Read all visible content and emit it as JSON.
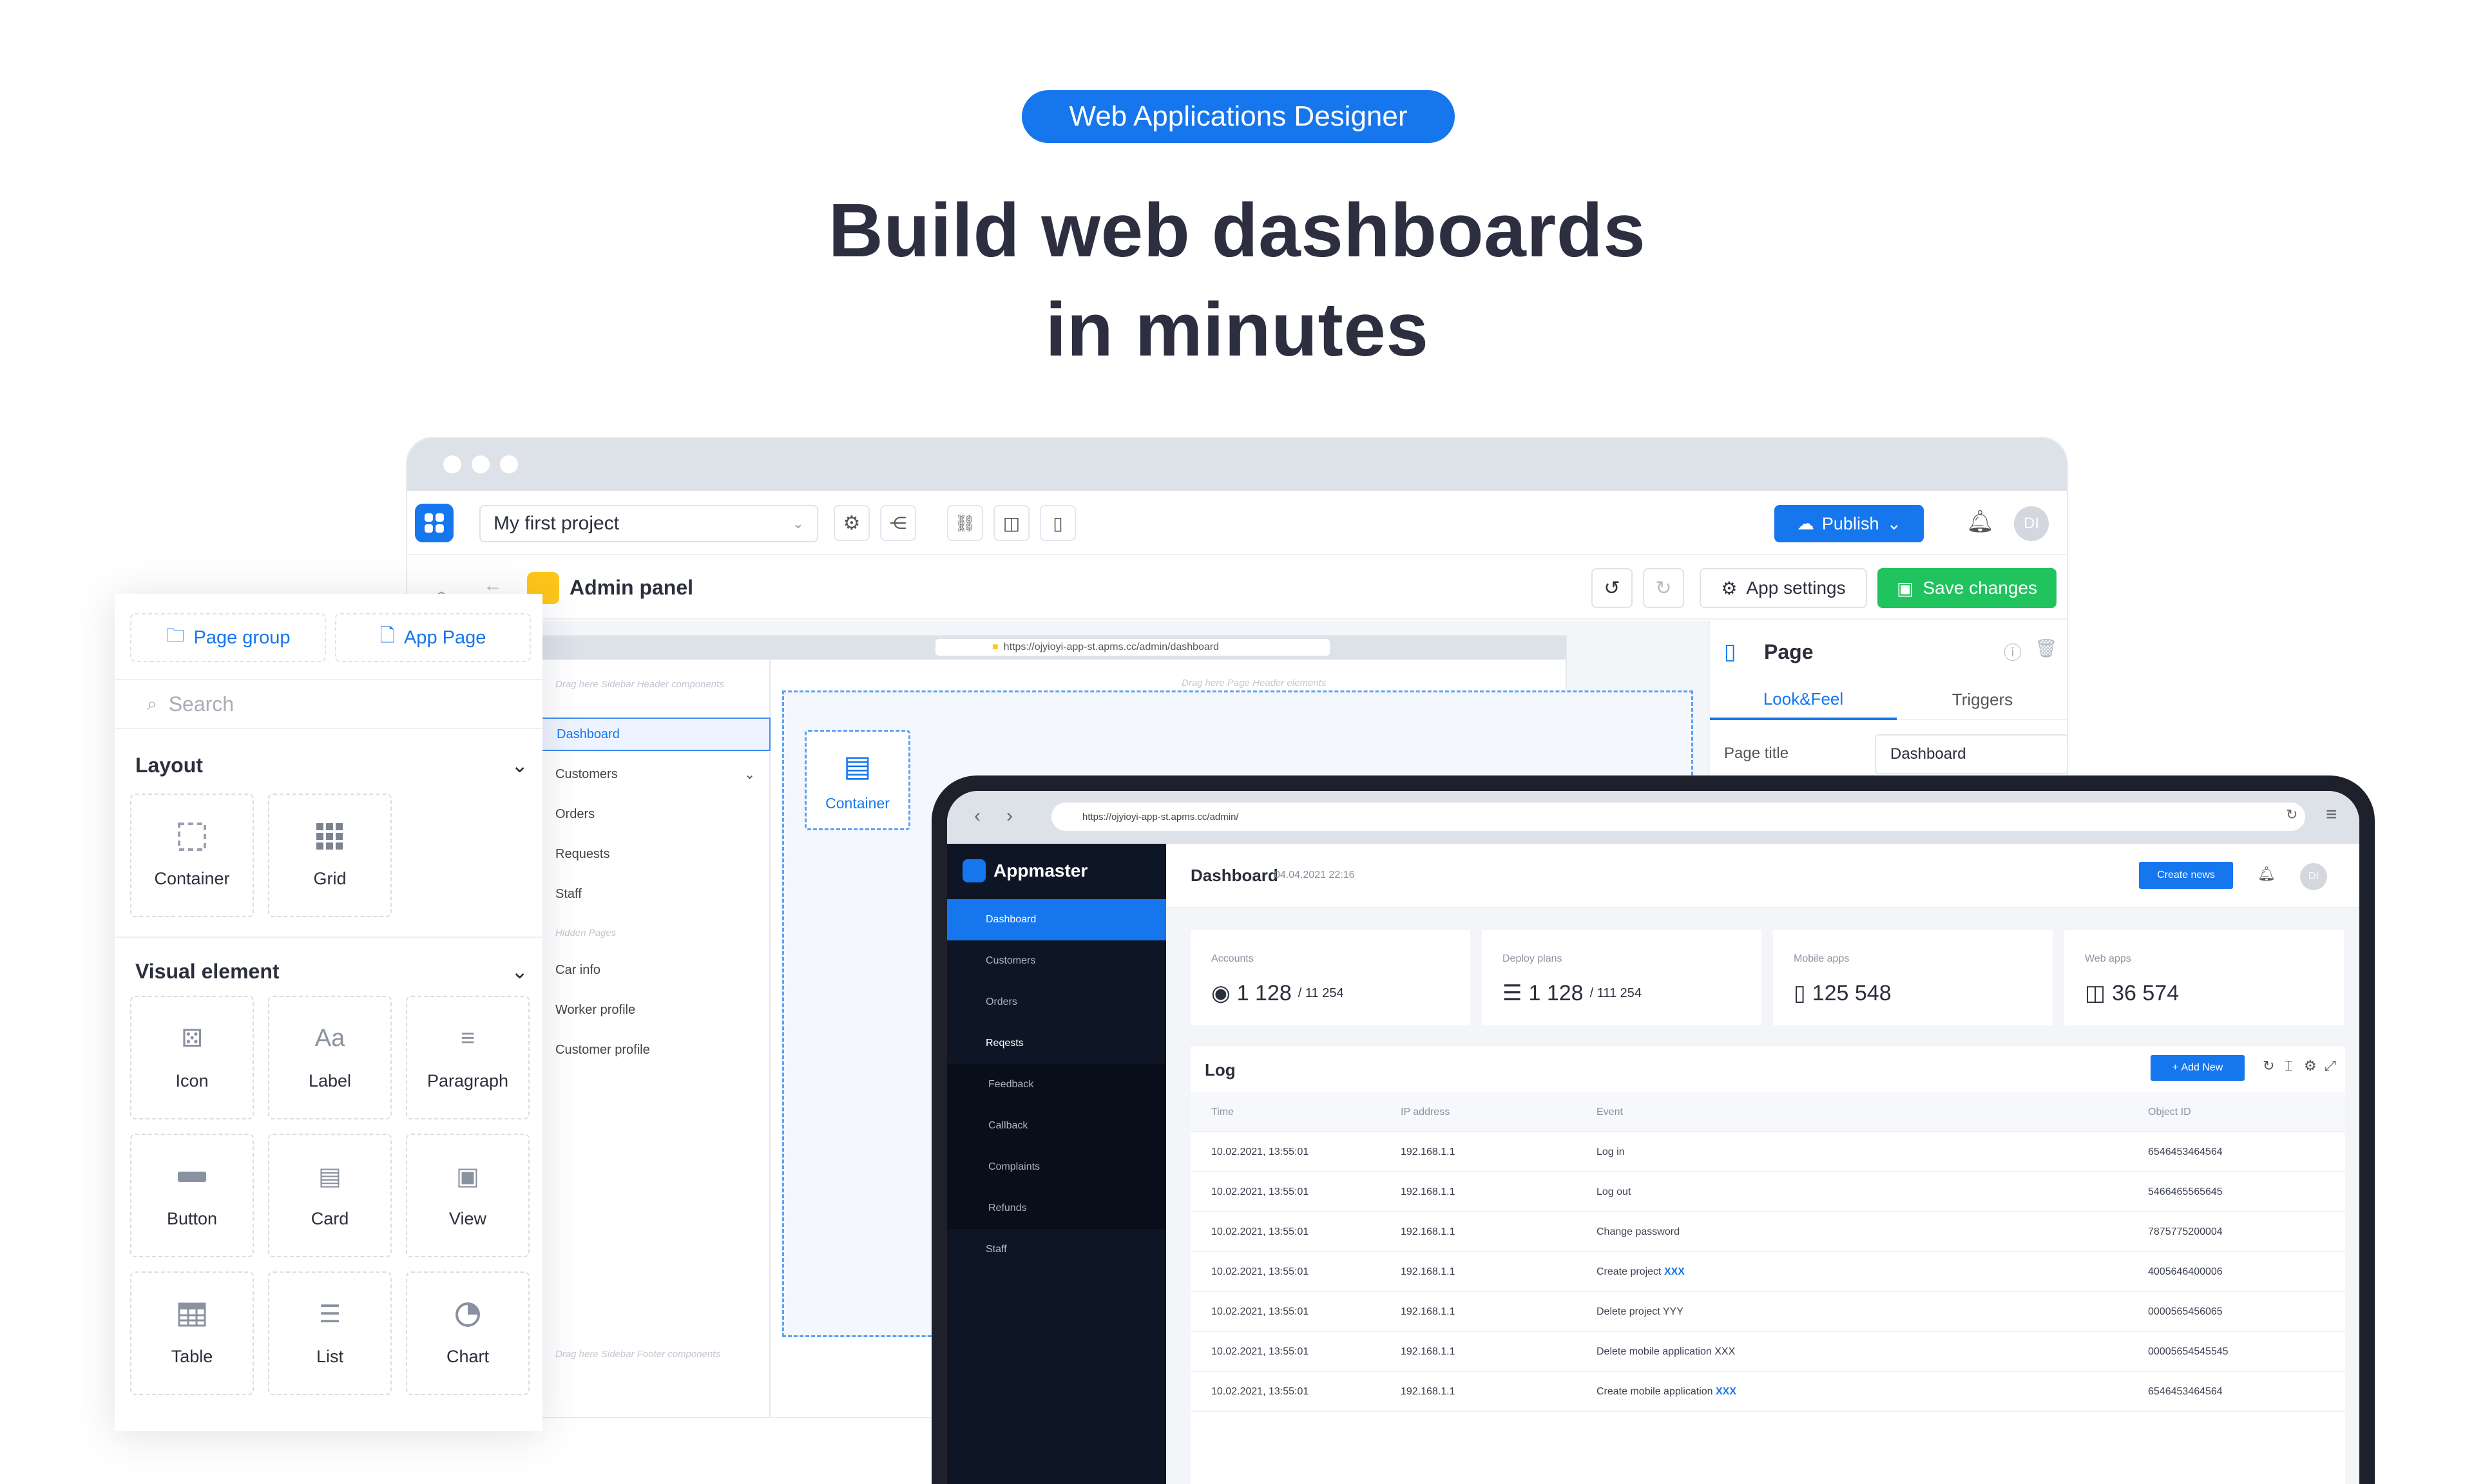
{
  "hero": {
    "badge": "Web Applications Designer",
    "title_line1": "Build web dashboards",
    "title_line2": "in minutes"
  },
  "editor": {
    "project": "My first project",
    "publish": "Publish",
    "avatar": "DI",
    "page_name": "Admin panel",
    "app_settings": "App settings",
    "save_changes": "Save changes",
    "url": "https://ojyioyi-app-st.apms.cc/admin/dashboard",
    "sidebar_header_hint": "Drag here Sidebar Header components",
    "page_header_hint": "Drag here Page Header elements",
    "sidebar_footer_hint": "Drag here Sidebar Footer components",
    "nav": [
      "Dashboard",
      "Customers",
      "Orders",
      "Requests",
      "Staff"
    ],
    "hidden_pages_label": "Hidden Pages",
    "hidden_pages": [
      "Car info",
      "Worker profile",
      "Customer profile"
    ],
    "container_label": "Container",
    "right_panel": {
      "title": "Page",
      "tab1": "Look&Feel",
      "tab2": "Triggers",
      "field_label": "Page title",
      "field_value": "Dashboard"
    }
  },
  "palette": {
    "btn_group": "Page group",
    "btn_page": "App Page",
    "search_placeholder": "Search",
    "layout_title": "Layout",
    "layout_items": [
      "Container",
      "Grid"
    ],
    "visual_title": "Visual element",
    "visual_items": [
      "Icon",
      "Label",
      "Paragraph",
      "Button",
      "Card",
      "View",
      "Table",
      "List",
      "Chart"
    ]
  },
  "preview": {
    "url": "https://ojyioyi-app-st.apms.cc/admin/",
    "brand": "Appmaster",
    "nav": [
      "Dashboard",
      "Customers",
      "Orders",
      "Reqests"
    ],
    "subnav": [
      "Feedback",
      "Callback",
      "Complaints",
      "Refunds"
    ],
    "nav_last": "Staff",
    "title": "Dashboard",
    "date": "04.04.2021 22:16",
    "create": "Create news",
    "avatar": "DI",
    "stats": [
      {
        "label": "Accounts",
        "value": "1 128",
        "sub": "/ 11 254"
      },
      {
        "label": "Deploy plans",
        "value": "1 128",
        "sub": "/ 111 254"
      },
      {
        "label": "Mobile apps",
        "value": "125 548",
        "sub": ""
      },
      {
        "label": "Web apps",
        "value": "36 574",
        "sub": ""
      }
    ],
    "log_title": "Log",
    "add_new": "Add New",
    "columns": [
      "Time",
      "IP address",
      "Event",
      "Object ID"
    ],
    "rows": [
      {
        "time": "10.02.2021, 13:55:01",
        "ip": "192.168.1.1",
        "event": "Log in",
        "hl": "",
        "id": "6546453464564"
      },
      {
        "time": "10.02.2021, 13:55:01",
        "ip": "192.168.1.1",
        "event": "Log out",
        "hl": "",
        "id": "5466465565645"
      },
      {
        "time": "10.02.2021, 13:55:01",
        "ip": "192.168.1.1",
        "event": "Change password",
        "hl": "",
        "id": "7875775200004"
      },
      {
        "time": "10.02.2021, 13:55:01",
        "ip": "192.168.1.1",
        "event": "Create project ",
        "hl": "XXX",
        "id": "4005646400006"
      },
      {
        "time": "10.02.2021, 13:55:01",
        "ip": "192.168.1.1",
        "event": "Delete project YYY",
        "hl": "",
        "id": "0000565456065"
      },
      {
        "time": "10.02.2021, 13:55:01",
        "ip": "192.168.1.1",
        "event": "Delete mobile application XXX",
        "hl": "",
        "id": "00005654545545"
      },
      {
        "time": "10.02.2021, 13:55:01",
        "ip": "192.168.1.1",
        "event": "Create mobile application ",
        "hl": "XXX",
        "id": "6546453464564"
      }
    ]
  }
}
